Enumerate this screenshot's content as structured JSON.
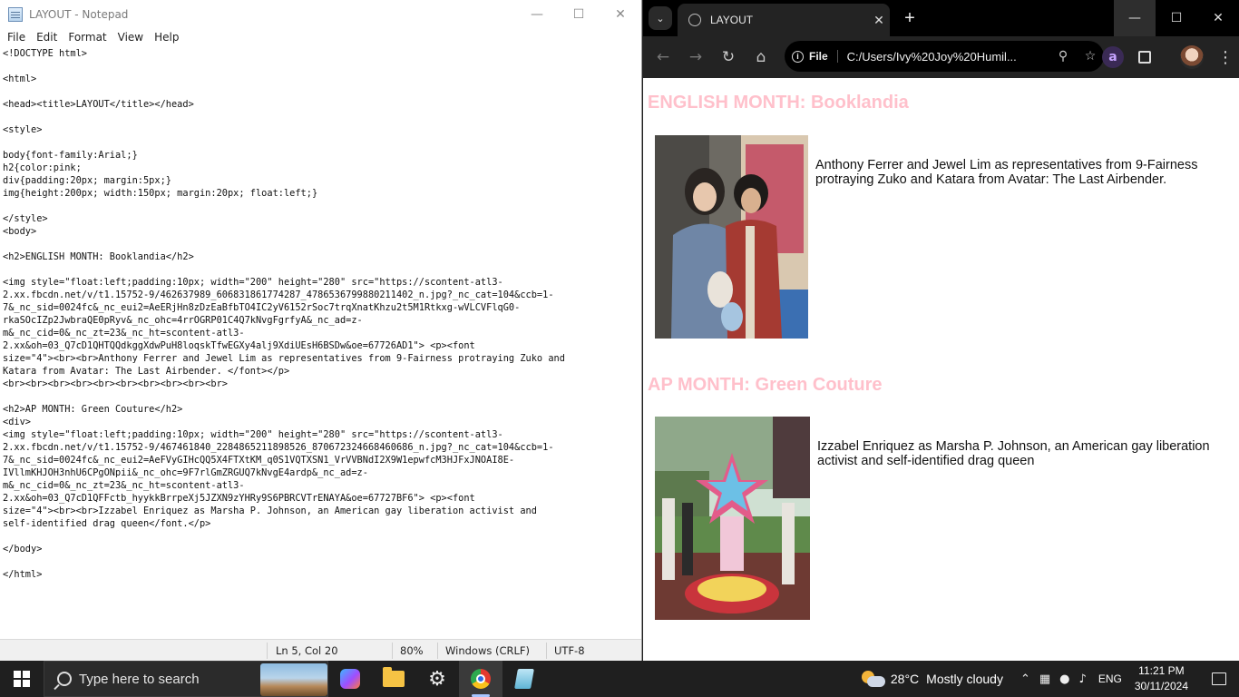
{
  "notepad": {
    "title": "LAYOUT - Notepad",
    "menu": [
      "File",
      "Edit",
      "Format",
      "View",
      "Help"
    ],
    "content": "<!DOCTYPE html>\n\n<html>\n\n<head><title>LAYOUT</title></head>\n\n<style>\n\nbody{font-family:Arial;}\nh2{color:pink;\ndiv{padding:20px; margin:5px;}\nimg{height:200px; width:150px; margin:20px; float:left;}\n\n</style>\n<body>\n\n<h2>ENGLISH MONTH: Booklandia</h2>\n\n<img style=\"float:left;padding:10px; width=\"200\" height=\"280\" src=\"https://scontent-atl3-\n2.xx.fbcdn.net/v/t1.15752-9/462637989_606831861774287_4786536799880211402_n.jpg?_nc_cat=104&ccb=1-\n7&_nc_sid=0024fc&_nc_eui2=AeERjHn8zDzEaBfbTO4IC2yV6152rSoc7trqXnatKhzu2t5M1Rtkxg-wVLCVFlqG0-\nrkaSOcIZp2JwbraQE0pRyv&_nc_ohc=4rrOGRP01C4Q7kNvgFgrfyA&_nc_ad=z-\nm&_nc_cid=0&_nc_zt=23&_nc_ht=scontent-atl3-\n2.xx&oh=03_Q7cD1QHTQQdkggXdwPuH8loqskTfwEGXy4alj9XdiUEsH6BSDw&oe=67726AD1\"> <p><font\nsize=\"4\"><br><br>Anthony Ferrer and Jewel Lim as representatives from 9-Fairness protraying Zuko and\nKatara from Avatar: The Last Airbender. </font></p>\n<br><br><br><br><br><br><br><br><br><br>\n\n<h2>AP MONTH: Green Couture</h2>\n<div>\n<img style=\"float:left;padding:10px; width=\"200\" height=\"280\" src=\"https://scontent-atl3-\n2.xx.fbcdn.net/v/t1.15752-9/467461840_2284865211898526_870672324668460686_n.jpg?_nc_cat=104&ccb=1-\n7&_nc_sid=0024fc&_nc_eui2=AeFVyGIHcQQ5X4FTXtKM_q0S1VQTXSN1_VrVVBNdI2X9W1epwfcM3HJFxJNOAI8E-\nIVllmKHJOH3nhU6CPgONpii&_nc_ohc=9F7rlGmZRGUQ7kNvgE4ardp&_nc_ad=z-\nm&_nc_cid=0&_nc_zt=23&_nc_ht=scontent-atl3-\n2.xx&oh=03_Q7cD1QFFctb_hyykkBrrpeXj5JZXN9zYHRy9S6PBRCVTrENAYA&oe=67727BF6\"> <p><font\nsize=\"4\"><br><br>Izzabel Enriquez as Marsha P. Johnson, an American gay liberation activist and\nself-identified drag queen</font.</p>\n\n</body>\n\n</html>",
    "status": {
      "position": "Ln 5, Col 20",
      "zoom": "80%",
      "line_ending": "Windows (CRLF)",
      "encoding": "UTF-8"
    }
  },
  "browser": {
    "tab_title": "LAYOUT",
    "address_chip": "File",
    "address": "C:/Users/Ivy%20Joy%20Humil...",
    "extension_letter": "a",
    "page": {
      "heading1": "ENGLISH MONTH: Booklandia",
      "caption1": "Anthony Ferrer and Jewel Lim as representatives from 9-Fairness protraying Zuko and Katara from Avatar: The Last Airbender.",
      "heading2": "AP MONTH: Green Couture",
      "caption2": "Izzabel Enriquez as Marsha P. Johnson, an American gay liberation activist and self-identified drag queen",
      "heading_color": "#ffc0cb"
    }
  },
  "taskbar": {
    "search_placeholder": "Type here to search",
    "weather_temp": "28°C",
    "weather_desc": "Mostly cloudy",
    "language": "ENG",
    "time": "11:21 PM",
    "date": "30/11/2024"
  }
}
